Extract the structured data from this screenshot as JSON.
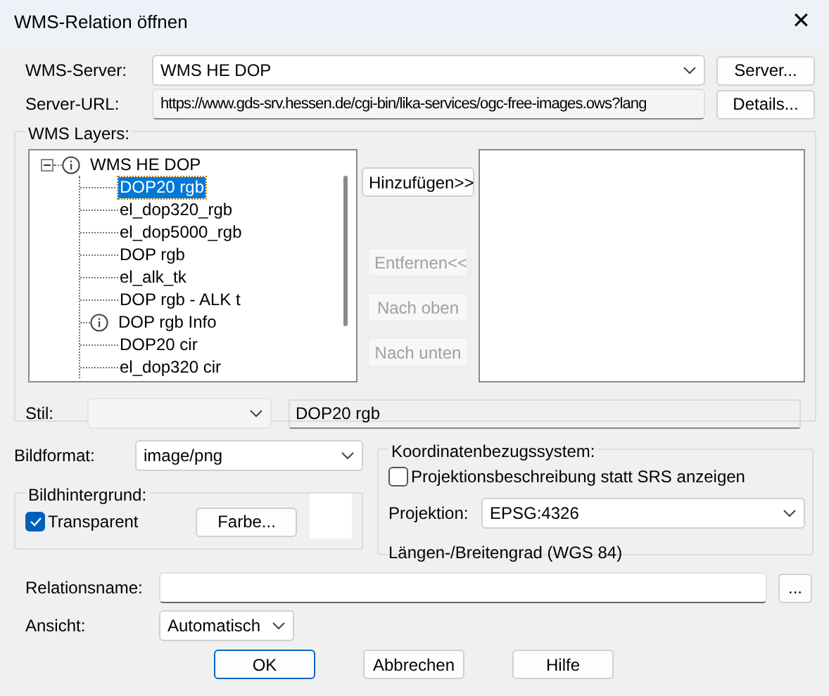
{
  "window": {
    "title": "WMS-Relation öffnen",
    "close": "✕"
  },
  "server": {
    "label": "WMS-Server:",
    "value": "WMS HE DOP",
    "button": "Server..."
  },
  "url": {
    "label": "Server-URL:",
    "value": "https://www.gds-srv.hessen.de/cgi-bin/lika-services/ogc-free-images.ows?lang",
    "button": "Details..."
  },
  "layers": {
    "title": "WMS Layers:",
    "tree": [
      {
        "label": "WMS HE DOP",
        "kind": "info",
        "expanded": true,
        "selected": false,
        "children": [
          {
            "label": "DOP20 rgb",
            "kind": "layer",
            "selected": true
          },
          {
            "label": "el_dop320_rgb",
            "kind": "layer",
            "selected": false
          },
          {
            "label": "el_dop5000_rgb",
            "kind": "layer",
            "selected": false
          },
          {
            "label": "DOP rgb",
            "kind": "layer",
            "selected": false
          },
          {
            "label": "el_alk_tk",
            "kind": "layer",
            "selected": false
          },
          {
            "label": "DOP rgb - ALK t",
            "kind": "layer",
            "selected": false
          },
          {
            "label": "DOP rgb Info",
            "kind": "info",
            "selected": false
          },
          {
            "label": "DOP20 cir",
            "kind": "layer",
            "selected": false
          },
          {
            "label": "el_dop320 cir",
            "kind": "layer",
            "selected": false
          }
        ]
      }
    ],
    "buttons": [
      {
        "label": "Hinzufügen>>",
        "disabled": false
      },
      {
        "label": "Entfernen<<",
        "disabled": true
      },
      {
        "label": "Nach oben",
        "disabled": true
      },
      {
        "label": "Nach unten",
        "disabled": true
      }
    ],
    "style": {
      "label": "Stil:",
      "disabled": true
    },
    "layer_name": "DOP20 rgb"
  },
  "format": {
    "label": "Bildformat:",
    "value": "image/png"
  },
  "background": {
    "title": "Bildhintergrund:",
    "transparent": {
      "label": "Transparent",
      "checked": true
    },
    "button": "Farbe..."
  },
  "crs": {
    "title": "Koordinatenbezugssystem:",
    "describe": {
      "label": "Projektionsbeschreibung statt SRS anzeigen",
      "checked": false
    },
    "projection_label": "Projektion:",
    "projection": "EPSG:4326",
    "description": "Längen-/Breitengrad (WGS 84)"
  },
  "relation": {
    "label": "Relationsname:",
    "button": "..."
  },
  "view": {
    "label": "Ansicht:",
    "value": "Automatisch"
  },
  "footer": [
    {
      "label": "OK",
      "default": true
    },
    {
      "label": "Abbrechen",
      "default": false
    },
    {
      "label": "Hilfe",
      "default": false
    }
  ]
}
